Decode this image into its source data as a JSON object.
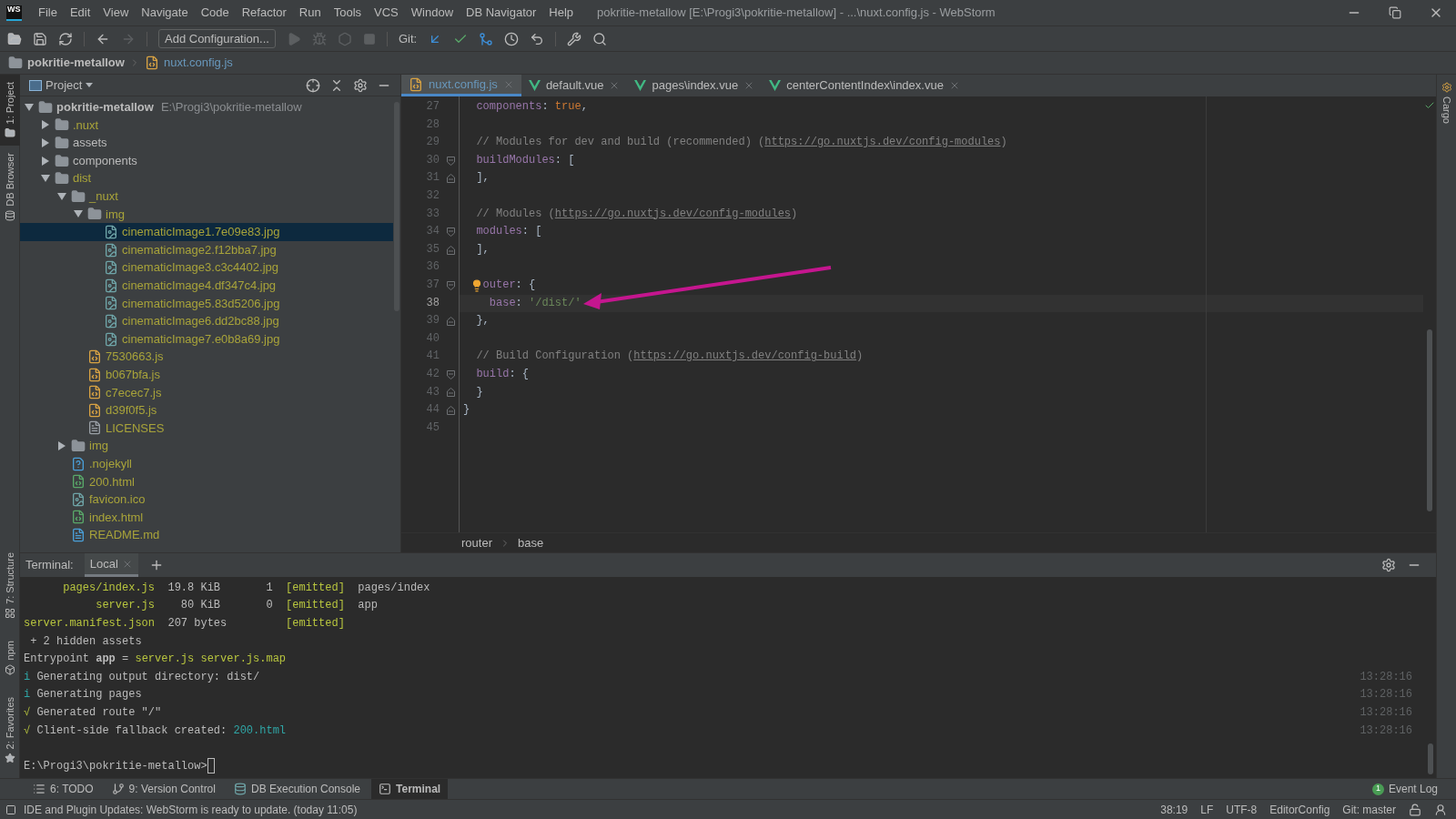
{
  "window": {
    "title": "pokritie-metallow [E:\\Progi3\\pokritie-metallow] - ...\\nuxt.config.js - WebStorm",
    "logo": "WS"
  },
  "menu": [
    "File",
    "Edit",
    "View",
    "Navigate",
    "Code",
    "Refactor",
    "Run",
    "Tools",
    "VCS",
    "Window",
    "DB Navigator",
    "Help"
  ],
  "toolbar": {
    "run_config": "Add Configuration...",
    "git_label": "Git:"
  },
  "nav_bar": {
    "project": "pokritie-metallow",
    "file": "nuxt.config.js"
  },
  "left_strip": [
    {
      "label": "1: Project",
      "selected": true
    },
    {
      "label": "DB Browser",
      "selected": false
    }
  ],
  "left_strip_bottom": [
    {
      "label": "7: Structure"
    },
    {
      "label": "npm"
    },
    {
      "label": "2: Favorites"
    }
  ],
  "right_strip": [
    {
      "label": "Cargo"
    }
  ],
  "project_panel": {
    "title": "Project",
    "root": {
      "name": "pokritie-metallow",
      "path": "E:\\Progi3\\pokritie-metallow",
      "expanded": true,
      "children": [
        {
          "name": ".nuxt",
          "kind": "folder",
          "ignored": true,
          "expanded": false,
          "selected": false
        },
        {
          "name": "assets",
          "kind": "folder",
          "ignored": false,
          "expanded": false,
          "selected": false
        },
        {
          "name": "components",
          "kind": "folder",
          "ignored": false,
          "expanded": false,
          "selected": false
        },
        {
          "name": "dist",
          "kind": "folder",
          "ignored": true,
          "expanded": true,
          "selected": false,
          "children": [
            {
              "name": "_nuxt",
              "kind": "folder",
              "ignored": true,
              "expanded": true,
              "selected": false,
              "children": [
                {
                  "name": "img",
                  "kind": "folder",
                  "ignored": true,
                  "expanded": true,
                  "selected": false,
                  "children": [
                    {
                      "name": "cinematicImage1.7e09e83.jpg",
                      "kind": "image",
                      "ignored": true,
                      "selected": true
                    },
                    {
                      "name": "cinematicImage2.f12bba7.jpg",
                      "kind": "image",
                      "ignored": true,
                      "selected": false
                    },
                    {
                      "name": "cinematicImage3.c3c4402.jpg",
                      "kind": "image",
                      "ignored": true,
                      "selected": false
                    },
                    {
                      "name": "cinematicImage4.df347c4.jpg",
                      "kind": "image",
                      "ignored": true,
                      "selected": false
                    },
                    {
                      "name": "cinematicImage5.83d5206.jpg",
                      "kind": "image",
                      "ignored": true,
                      "selected": false
                    },
                    {
                      "name": "cinematicImage6.dd2bc88.jpg",
                      "kind": "image",
                      "ignored": true,
                      "selected": false
                    },
                    {
                      "name": "cinematicImage7.e0b8a69.jpg",
                      "kind": "image",
                      "ignored": true,
                      "selected": false
                    }
                  ]
                },
                {
                  "name": "7530663.js",
                  "kind": "js",
                  "ignored": true,
                  "selected": false
                },
                {
                  "name": "b067bfa.js",
                  "kind": "js",
                  "ignored": true,
                  "selected": false
                },
                {
                  "name": "c7ecec7.js",
                  "kind": "js",
                  "ignored": true,
                  "selected": false
                },
                {
                  "name": "d39f0f5.js",
                  "kind": "js",
                  "ignored": true,
                  "selected": false
                },
                {
                  "name": "LICENSES",
                  "kind": "text",
                  "ignored": true,
                  "selected": false
                }
              ]
            },
            {
              "name": "img",
              "kind": "folder",
              "ignored": true,
              "expanded": false,
              "selected": false
            },
            {
              "name": ".nojekyll",
              "kind": "unknown",
              "ignored": true,
              "selected": false
            },
            {
              "name": "200.html",
              "kind": "html",
              "ignored": true,
              "selected": false
            },
            {
              "name": "favicon.ico",
              "kind": "image",
              "ignored": true,
              "selected": false
            },
            {
              "name": "index.html",
              "kind": "html",
              "ignored": true,
              "selected": false
            },
            {
              "name": "README.md",
              "kind": "markdown",
              "ignored": true,
              "selected": false
            }
          ]
        }
      ]
    }
  },
  "tabs": [
    {
      "label": "nuxt.config.js",
      "kind": "js",
      "selected": true
    },
    {
      "label": "default.vue",
      "kind": "vue",
      "selected": false
    },
    {
      "label": "pages\\index.vue",
      "kind": "vue",
      "selected": false
    },
    {
      "label": "centerContentIndex\\index.vue",
      "kind": "vue",
      "selected": false
    }
  ],
  "editor": {
    "lines": [
      {
        "number": "27",
        "current": false,
        "kind": "plain",
        "tokens": [
          {
            "text": "  components",
            "kind": "key"
          },
          {
            "text": ": ",
            "kind": "punct"
          },
          {
            "text": "true",
            "kind": "keyword"
          },
          {
            "text": ",",
            "kind": "punct"
          }
        ]
      },
      {
        "number": "28",
        "current": false,
        "kind": "plain"
      },
      {
        "number": "29",
        "current": false,
        "kind": "plain",
        "tokens": [
          {
            "text": "  // Modules for dev and build (recommended) (",
            "kind": "comment"
          },
          {
            "text": "https://go.nuxtjs.dev/config-modules",
            "kind": "link"
          },
          {
            "text": ")",
            "kind": "comment"
          }
        ]
      },
      {
        "number": "30",
        "current": false,
        "kind": "opener",
        "tokens": [
          {
            "text": "  buildModules",
            "kind": "key"
          },
          {
            "text": ": [",
            "kind": "punct"
          }
        ]
      },
      {
        "number": "31",
        "current": false,
        "kind": "closer",
        "tokens": [
          {
            "text": "  ],",
            "kind": "punct"
          }
        ]
      },
      {
        "number": "32",
        "current": false,
        "kind": "plain"
      },
      {
        "number": "33",
        "current": false,
        "kind": "plain",
        "tokens": [
          {
            "text": "  // Modules (",
            "kind": "comment"
          },
          {
            "text": "https://go.nuxtjs.dev/config-modules",
            "kind": "link"
          },
          {
            "text": ")",
            "kind": "comment"
          }
        ]
      },
      {
        "number": "34",
        "current": false,
        "kind": "opener",
        "tokens": [
          {
            "text": "  modules",
            "kind": "key"
          },
          {
            "text": ": [",
            "kind": "punct"
          }
        ]
      },
      {
        "number": "35",
        "current": false,
        "kind": "closer",
        "tokens": [
          {
            "text": "  ],",
            "kind": "punct"
          }
        ]
      },
      {
        "number": "36",
        "current": false,
        "kind": "plain"
      },
      {
        "number": "37",
        "current": false,
        "kind": "opener",
        "hint": true,
        "tokens": [
          {
            "text": "outer",
            "kind": "key"
          },
          {
            "text": ": {",
            "kind": "punct"
          }
        ]
      },
      {
        "number": "38",
        "current": true,
        "kind": "plain",
        "tokens": [
          {
            "text": "    base",
            "kind": "key"
          },
          {
            "text": ": ",
            "kind": "punct"
          },
          {
            "text": "'/dist/'",
            "kind": "string"
          }
        ]
      },
      {
        "number": "39",
        "current": false,
        "kind": "closer",
        "tokens": [
          {
            "text": "  },",
            "kind": "punct"
          }
        ]
      },
      {
        "number": "40",
        "current": false,
        "kind": "plain"
      },
      {
        "number": "41",
        "current": false,
        "kind": "plain",
        "tokens": [
          {
            "text": "  // Build Configuration (",
            "kind": "comment"
          },
          {
            "text": "https://go.nuxtjs.dev/config-build",
            "kind": "link"
          },
          {
            "text": ")",
            "kind": "comment"
          }
        ]
      },
      {
        "number": "42",
        "current": false,
        "kind": "opener",
        "tokens": [
          {
            "text": "  build",
            "kind": "key"
          },
          {
            "text": ": {",
            "kind": "punct"
          }
        ]
      },
      {
        "number": "43",
        "current": false,
        "kind": "closer",
        "tokens": [
          {
            "text": "  }",
            "kind": "punct"
          }
        ]
      },
      {
        "number": "44",
        "current": false,
        "kind": "closer",
        "tokens": [
          {
            "text": "}",
            "kind": "punct"
          }
        ]
      },
      {
        "number": "45",
        "current": false,
        "kind": "plain"
      }
    ],
    "breadcrumbs": [
      "router",
      "base"
    ]
  },
  "terminal": {
    "label": "Terminal:",
    "tabs": [
      {
        "label": "Local",
        "selected": true
      }
    ],
    "lines": [
      {
        "tokens": [
          {
            "text": "      pages/index.js",
            "kind": "file"
          },
          {
            "text": "  19.8 KiB       1  ",
            "kind": "plain"
          },
          {
            "text": "[emitted]",
            "kind": "file"
          },
          {
            "text": "  pages/index",
            "kind": "plain"
          }
        ]
      },
      {
        "tokens": [
          {
            "text": "           server.js",
            "kind": "file"
          },
          {
            "text": "    80 KiB       0  ",
            "kind": "plain"
          },
          {
            "text": "[emitted]",
            "kind": "file"
          },
          {
            "text": "  app",
            "kind": "plain"
          }
        ]
      },
      {
        "tokens": [
          {
            "text": "server.manifest.json",
            "kind": "file"
          },
          {
            "text": "  207 bytes         ",
            "kind": "plain"
          },
          {
            "text": "[emitted]",
            "kind": "file"
          }
        ]
      },
      {
        "tokens": [
          {
            "text": " + 2 hidden assets",
            "kind": "plain"
          }
        ]
      },
      {
        "tokens": [
          {
            "text": "Entrypoint ",
            "kind": "plain"
          },
          {
            "text": "app",
            "kind": "bold"
          },
          {
            "text": " = ",
            "kind": "plain"
          },
          {
            "text": "server.js server.js.map",
            "kind": "file"
          }
        ]
      },
      {
        "time": "13:28:16",
        "tokens": [
          {
            "text": "i",
            "kind": "info"
          },
          {
            "text": " Generating output directory: dist/",
            "kind": "plain"
          }
        ]
      },
      {
        "time": "13:28:16",
        "tokens": [
          {
            "text": "i",
            "kind": "info"
          },
          {
            "text": " Generating pages",
            "kind": "plain"
          }
        ]
      },
      {
        "time": "13:28:16",
        "tokens": [
          {
            "text": "√",
            "kind": "file"
          },
          {
            "text": " Generated route \"/\"",
            "kind": "plain"
          }
        ]
      },
      {
        "time": "13:28:16",
        "tokens": [
          {
            "text": "√",
            "kind": "file"
          },
          {
            "text": " Client-side fallback created: ",
            "kind": "plain"
          },
          {
            "text": "200.html",
            "kind": "info"
          }
        ]
      },
      {
        "kind": "prompt",
        "tokens": [
          {
            "text": "E:\\Progi3\\pokritie-metallow>",
            "kind": "plain"
          }
        ],
        "cursor": true
      }
    ]
  },
  "tool_windows": [
    {
      "label": "6: TODO",
      "kind": "list",
      "selected": false
    },
    {
      "label": "9: Version Control",
      "kind": "vcs",
      "selected": false
    },
    {
      "label": "DB Execution Console",
      "kind": "db",
      "selected": false
    },
    {
      "label": "Terminal",
      "kind": "terminal",
      "selected": true
    }
  ],
  "event_log": {
    "label": "Event Log",
    "count": "1"
  },
  "status_bar": {
    "message": "IDE and Plugin Updates: WebStorm is ready to update. (today 11:05)",
    "position": "38:19",
    "line_separator": "LF",
    "encoding": "UTF-8",
    "editor_config": "EditorConfig",
    "branch": "Git: master"
  }
}
